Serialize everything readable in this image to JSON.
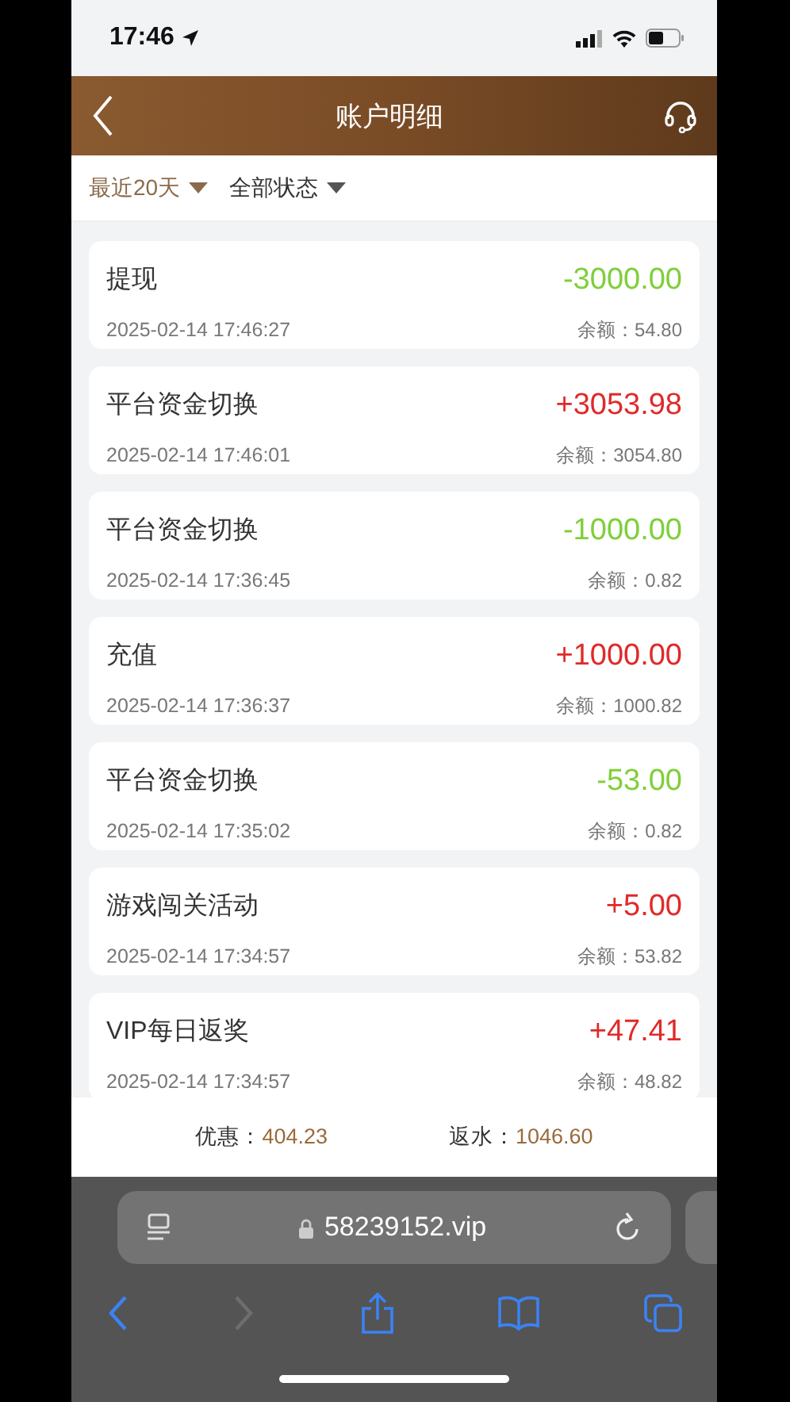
{
  "status_bar": {
    "time": "17:46"
  },
  "header": {
    "title": "账户明细"
  },
  "filters": [
    {
      "label": "最近20天",
      "selected": true
    },
    {
      "label": "全部状态",
      "selected": false
    }
  ],
  "transactions": [
    {
      "title": "提现",
      "time": "2025-02-14 17:46:27",
      "amount": "-3000.00",
      "kind": "expense",
      "balance_label": "余额：",
      "balance": "54.80"
    },
    {
      "title": "平台资金切换",
      "time": "2025-02-14 17:46:01",
      "amount": "+3053.98",
      "kind": "income",
      "balance_label": "余额：",
      "balance": "3054.80"
    },
    {
      "title": "平台资金切换",
      "time": "2025-02-14 17:36:45",
      "amount": "-1000.00",
      "kind": "expense",
      "balance_label": "余额：",
      "balance": "0.82"
    },
    {
      "title": "充值",
      "time": "2025-02-14 17:36:37",
      "amount": "+1000.00",
      "kind": "income",
      "balance_label": "余额：",
      "balance": "1000.82"
    },
    {
      "title": "平台资金切换",
      "time": "2025-02-14 17:35:02",
      "amount": "-53.00",
      "kind": "expense",
      "balance_label": "余额：",
      "balance": "0.82"
    },
    {
      "title": "游戏闯关活动",
      "time": "2025-02-14 17:34:57",
      "amount": "+5.00",
      "kind": "income",
      "balance_label": "余额：",
      "balance": "53.82"
    },
    {
      "title": "VIP每日返奖",
      "time": "2025-02-14 17:34:57",
      "amount": "+47.41",
      "kind": "income",
      "balance_label": "余额：",
      "balance": "48.82"
    }
  ],
  "summary": [
    {
      "label": "优惠：",
      "value": "404.23"
    },
    {
      "label": "返水：",
      "value": "1046.60"
    }
  ],
  "browser": {
    "url": "58239152.vip"
  }
}
